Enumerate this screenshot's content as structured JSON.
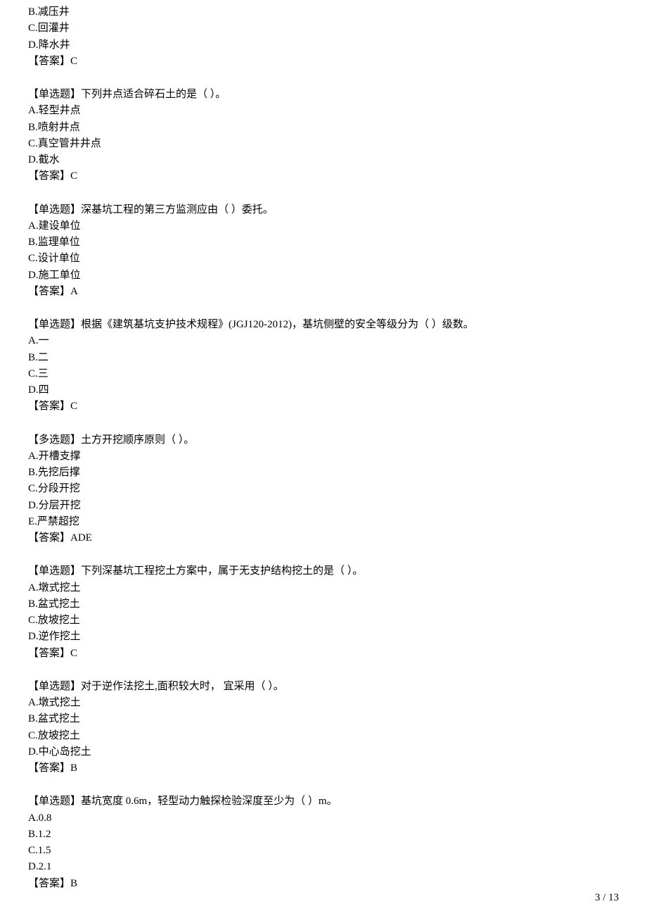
{
  "questions": [
    {
      "partial_options": [
        "B.减压井",
        "C.回灌井",
        "D.降水井"
      ],
      "answer": "【答案】C"
    },
    {
      "stem": "【单选题】下列井点适合碎石土的是（  ）。",
      "options": [
        "A.轻型井点",
        "B.喷射井点",
        "C.真空管井井点",
        "D.截水"
      ],
      "answer": "【答案】C"
    },
    {
      "stem": "【单选题】深基坑工程的第三方监测应由（  ）委托。",
      "options": [
        "A.建设单位",
        "B.监理单位",
        "C.设计单位",
        "D.施工单位"
      ],
      "answer": "【答案】A"
    },
    {
      "stem": "【单选题】根据《建筑基坑支护技术规程》(JGJ120-2012)，基坑侧壁的安全等级分为（  ）级数。",
      "options": [
        "A.一",
        "B.二",
        "C.三",
        "D.四"
      ],
      "answer": "【答案】C"
    },
    {
      "stem": "【多选题】土方开挖顺序原则（  ）。",
      "options": [
        "A.开槽支撑",
        "B.先挖后撑",
        "C.分段开挖",
        "D.分层开挖",
        "E.严禁超挖"
      ],
      "answer": "【答案】ADE"
    },
    {
      "stem": "【单选题】下列深基坑工程挖土方案中，属于无支护结构挖土的是（  ）。",
      "options": [
        "A.墩式挖土",
        "B.盆式挖土",
        "C.放坡挖土",
        "D.逆作挖土"
      ],
      "answer": "【答案】C"
    },
    {
      "stem": "【单选题】对于逆作法挖土,面积较大时， 宜采用（  ）。",
      "options": [
        "A.墩式挖土",
        "B.盆式挖土",
        "C.放坡挖土",
        "D.中心岛挖土"
      ],
      "answer": "【答案】B"
    },
    {
      "stem": "【单选题】基坑宽度 0.6m，轻型动力触探检验深度至少为（  ）m。",
      "options": [
        "A.0.8",
        "B.1.2",
        "C.1.5",
        "D.2.1"
      ],
      "answer": "【答案】B"
    }
  ],
  "footer": {
    "page": "3 / 13"
  }
}
